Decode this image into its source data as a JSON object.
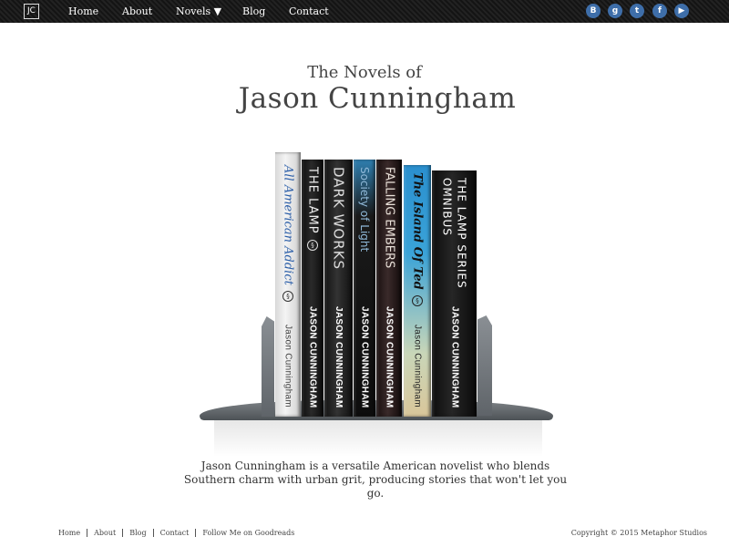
{
  "nav": {
    "logo": "JC",
    "items": [
      {
        "label": "Home"
      },
      {
        "label": "About"
      },
      {
        "label": "Novels ▼"
      },
      {
        "label": "Blog"
      },
      {
        "label": "Contact"
      }
    ],
    "social": [
      {
        "icon": "blogger-icon",
        "glyph": "B"
      },
      {
        "icon": "goodreads-icon",
        "glyph": "g"
      },
      {
        "icon": "twitter-icon",
        "glyph": "t"
      },
      {
        "icon": "facebook-icon",
        "glyph": "f"
      },
      {
        "icon": "youtube-icon",
        "glyph": "▶"
      }
    ],
    "social_color": "#3e6ea9"
  },
  "header": {
    "subtitle": "The Novels of",
    "title": "Jason Cunningham"
  },
  "books": [
    {
      "title": "All American Addict",
      "author": "Jason Cunningham"
    },
    {
      "title": "THE LAMP",
      "author": "JASON CUNNINGHAM"
    },
    {
      "title": "DARK WORKS",
      "author": "JASON CUNNINGHAM"
    },
    {
      "title": "Society of Light",
      "author": "JASON CUNNINGHAM"
    },
    {
      "title": "FALLING EMBERS",
      "author": "JASON CUNNINGHAM"
    },
    {
      "title": "The Island Of Ted",
      "author": "Jason Cunningham"
    },
    {
      "title": "THE LAMP SERIES OMNIBUS",
      "author": "JASON CUNNINGHAM"
    }
  ],
  "blurb": "Jason Cunningham is a versatile American novelist who blends Southern charm with urban grit, producing stories that won't let you go.",
  "footer": {
    "links": [
      {
        "label": "Home"
      },
      {
        "label": "About"
      },
      {
        "label": "Blog"
      },
      {
        "label": "Contact"
      },
      {
        "label": "Follow Me on Goodreads"
      }
    ],
    "copyright": "Copyright © 2015 Metaphor Studios"
  }
}
